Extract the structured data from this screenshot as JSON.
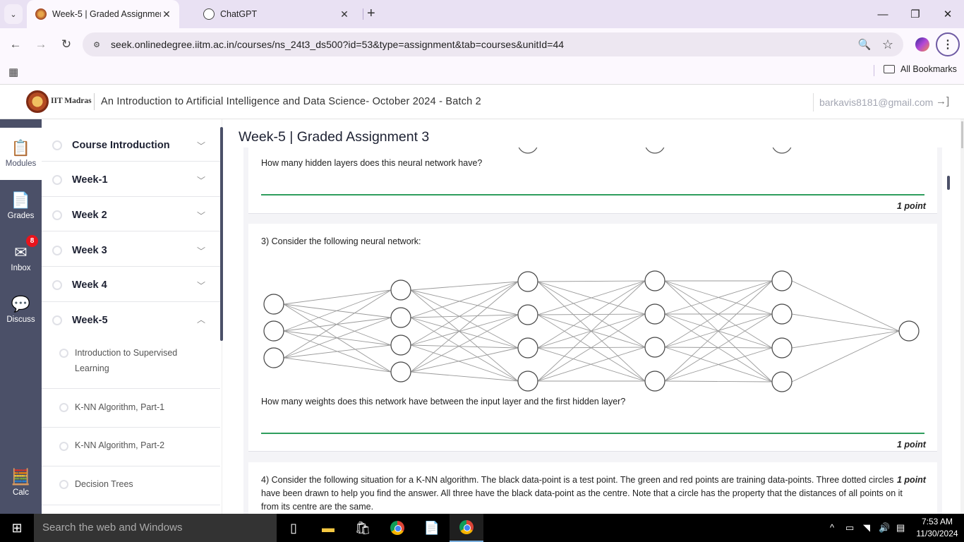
{
  "browser": {
    "tabs": [
      {
        "title": "Week-5 | Graded Assignment 3",
        "active": true,
        "favicon": "iitm-logo"
      },
      {
        "title": "ChatGPT",
        "active": false,
        "favicon": "chatgpt-logo"
      }
    ],
    "tab_close_glyph": "✕",
    "new_tab_glyph": "+",
    "tab_search_glyph": "⌄",
    "window_controls": {
      "minimize": "—",
      "restore": "❐",
      "close": "✕"
    },
    "nav": {
      "back": "←",
      "forward": "→",
      "reload": "↻"
    },
    "url": "seek.onlinedegree.iitm.ac.in/courses/ns_24t3_ds500?id=53&type=assignment&tab=courses&unitId=44",
    "site_info_glyph": "⚙",
    "zoom_glyph": "🔍",
    "star_glyph": "☆",
    "menu_glyph": "⋮",
    "apps_glyph": "▦",
    "all_bookmarks": "All Bookmarks"
  },
  "site": {
    "org": "IIT Madras",
    "course_title": "An Introduction to Artificial Intelligence and Data Science- October 2024 - Batch 2",
    "user_email": "barkavis8181@gmail.com",
    "logout_glyph": "→]"
  },
  "rail": [
    {
      "label": "Modules",
      "icon": "📋",
      "active": true
    },
    {
      "label": "Grades",
      "icon": "📄",
      "active": false
    },
    {
      "label": "Inbox",
      "icon": "✉",
      "active": false,
      "badge": "8"
    },
    {
      "label": "Discuss",
      "icon": "💬",
      "active": false
    },
    {
      "label": "Calc",
      "icon": "🧮",
      "active": false
    }
  ],
  "modules": {
    "items": [
      {
        "label": "Course Introduction",
        "chevron": "﹀"
      },
      {
        "label": "Week-1",
        "chevron": "﹀"
      },
      {
        "label": "Week 2",
        "chevron": "﹀"
      },
      {
        "label": "Week 3",
        "chevron": "﹀"
      },
      {
        "label": "Week 4",
        "chevron": "﹀"
      },
      {
        "label": "Week-5",
        "chevron": "︿"
      }
    ],
    "subitems": [
      {
        "label": "Introduction to Supervised Learning"
      },
      {
        "label": "K-NN Algorithm, Part-1"
      },
      {
        "label": "K-NN Algorithm, Part-2"
      },
      {
        "label": "Decision Trees"
      }
    ],
    "collapse_glyph": "‹"
  },
  "assignment": {
    "title": "Week-5 | Graded Assignment 3",
    "questions": [
      {
        "text": "How many hidden layers does this neural network have?",
        "points": "1 point",
        "answer": ""
      },
      {
        "number": "3)",
        "intro": "Consider the following neural network:",
        "text": "How many weights does this network have between the input layer and the first hidden layer?",
        "points": "1 point",
        "answer": "",
        "network_layers": [
          3,
          4,
          4,
          4,
          4,
          1
        ]
      },
      {
        "number": "4)",
        "text": "Consider the following situation for a K-NN algorithm. The black data-point is a test point. The green and red points are training data-points. Three dotted circles have been drawn to help you find the answer. All three have the black data-point as the centre. Note that a circle has the property that the distances of all points on it from its centre are the same.",
        "points": "1 point"
      }
    ]
  },
  "taskbar": {
    "search_placeholder": "Search the web and Windows",
    "start_glyph": "⊞",
    "time": "7:53 AM",
    "date": "11/30/2024",
    "tray_glyphs": {
      "chevron": "^",
      "battery": "▭",
      "wifi": "◥",
      "volume": "🔊",
      "notifications": "▤"
    }
  },
  "colors": {
    "rail_bg": "#4b5068",
    "answer_line": "#2f9e5e",
    "badge": "#e8141c"
  }
}
